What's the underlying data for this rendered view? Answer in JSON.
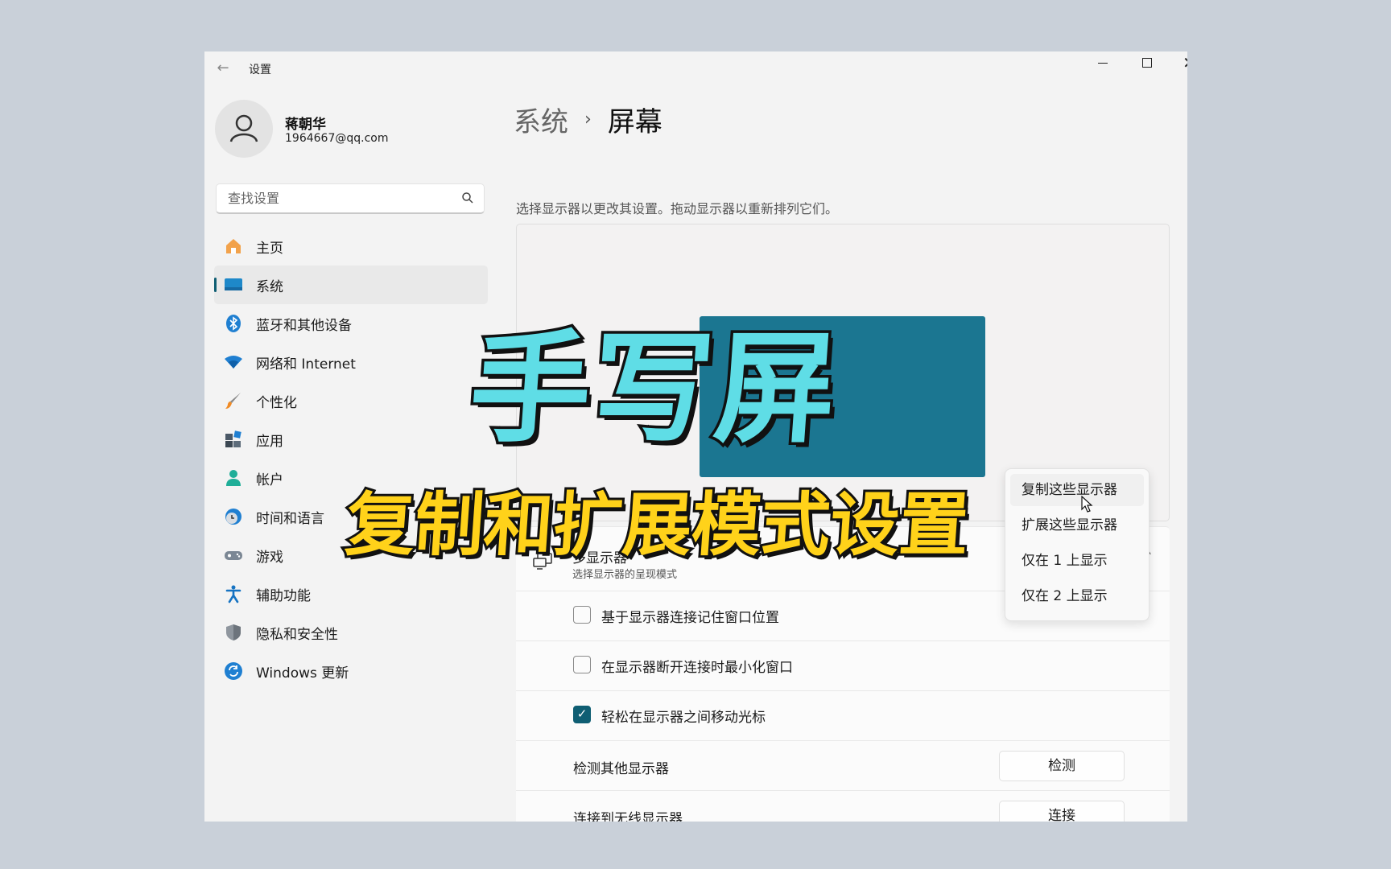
{
  "window": {
    "title": "设置"
  },
  "user": {
    "name": "蒋朝华",
    "email": "1964667@qq.com"
  },
  "search": {
    "placeholder": "查找设置"
  },
  "sidebar": {
    "items": [
      {
        "label": "主页",
        "icon": "home-icon"
      },
      {
        "label": "系统",
        "icon": "system-icon",
        "active": true
      },
      {
        "label": "蓝牙和其他设备",
        "icon": "bluetooth-icon"
      },
      {
        "label": "网络和 Internet",
        "icon": "wifi-icon"
      },
      {
        "label": "个性化",
        "icon": "brush-icon"
      },
      {
        "label": "应用",
        "icon": "apps-icon"
      },
      {
        "label": "帐户",
        "icon": "account-icon"
      },
      {
        "label": "时间和语言",
        "icon": "clock-globe-icon"
      },
      {
        "label": "游戏",
        "icon": "gamepad-icon"
      },
      {
        "label": "辅助功能",
        "icon": "accessibility-icon"
      },
      {
        "label": "隐私和安全性",
        "icon": "shield-icon"
      },
      {
        "label": "Windows 更新",
        "icon": "update-icon"
      }
    ]
  },
  "breadcrumb": {
    "parent": "系统",
    "separator": "›",
    "current": "屏幕"
  },
  "main": {
    "instruction": "选择显示器以更改其设置。拖动显示器以重新排列它们。",
    "multi_display": {
      "title": "多显示器",
      "subtitle": "选择显示器的呈现模式"
    },
    "checkboxes": [
      {
        "label": "基于显示器连接记住窗口位置",
        "checked": false
      },
      {
        "label": "在显示器断开连接时最小化窗口",
        "checked": false
      },
      {
        "label": "轻松在显示器之间移动光标",
        "checked": true
      }
    ],
    "detect": {
      "label": "检测其他显示器",
      "button": "检测"
    },
    "wireless": {
      "label": "连接到无线显示器",
      "button": "连接"
    }
  },
  "dropdown": {
    "options": [
      "复制这些显示器",
      "扩展这些显示器",
      "仅在 1 上显示",
      "仅在 2 上显示"
    ],
    "hovered_index": 0
  },
  "overlay": {
    "title": "手写屏",
    "subtitle": "复制和扩展模式设置"
  },
  "colors": {
    "accent": "#0f5e73",
    "monitor": "#1b7691",
    "title_fill": "#5fdde6",
    "subtitle_fill": "#ffd21a"
  }
}
